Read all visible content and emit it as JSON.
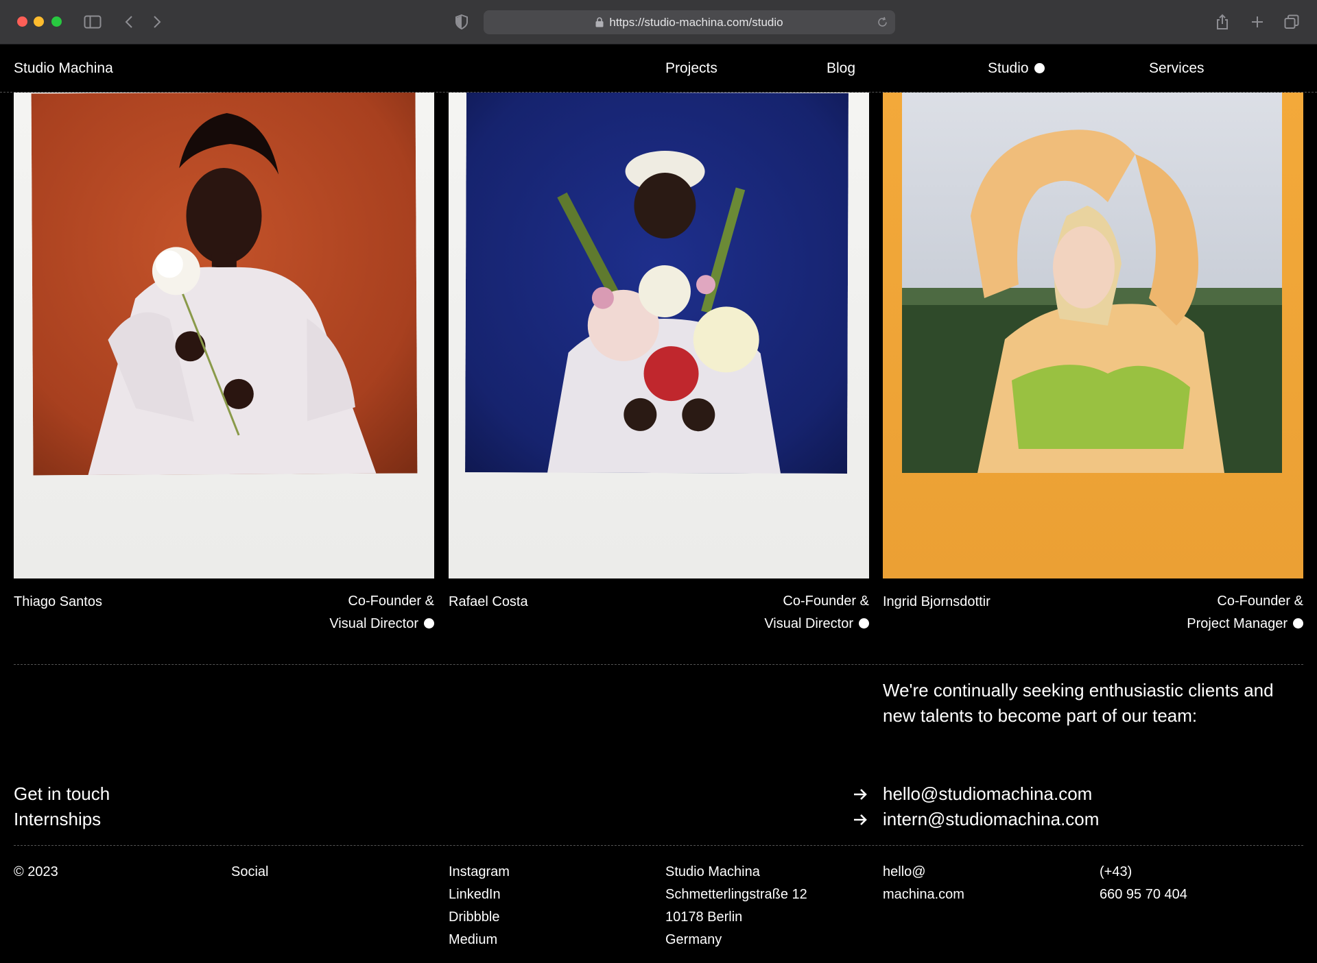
{
  "browser": {
    "url": "https://studio-machina.com/studio"
  },
  "nav": {
    "brand": "Studio Machina",
    "items": [
      {
        "label": "Projects"
      },
      {
        "label": "Blog"
      },
      {
        "label": "Studio"
      },
      {
        "label": "Services"
      }
    ]
  },
  "team": [
    {
      "name": "Thiago Santos",
      "role_line1": "Co-Founder &",
      "role_line2": "Visual Director"
    },
    {
      "name": "Rafael Costa",
      "role_line1": "Co-Founder &",
      "role_line2": "Visual Director"
    },
    {
      "name": "Ingrid Bjornsdottir",
      "role_line1": "Co-Founder &",
      "role_line2": "Project Manager"
    }
  ],
  "seeking": "We're continually seeking enthusiastic clients and new talents to become part of our team:",
  "contacts": [
    {
      "label": "Get in touch",
      "email": "hello@studiomachina.com"
    },
    {
      "label": "Internships",
      "email": "intern@studiomachina.com"
    }
  ],
  "footer": {
    "copyright": "© 2023",
    "social_heading": "Social",
    "social_links": [
      "Instagram",
      "LinkedIn",
      "Dribbble",
      "Medium"
    ],
    "address": [
      "Studio Machina",
      "Schmetterlingstraße 12",
      "10178 Berlin",
      "Germany"
    ],
    "email_lines": [
      "hello@",
      "machina.com"
    ],
    "phone_lines": [
      "(+43)",
      "660 95 70 404"
    ]
  },
  "colors": {
    "background": "#000000",
    "text": "#ffffff",
    "polaroid_white": "#f2f2f0",
    "polaroid_yellow": "#f0a637"
  }
}
